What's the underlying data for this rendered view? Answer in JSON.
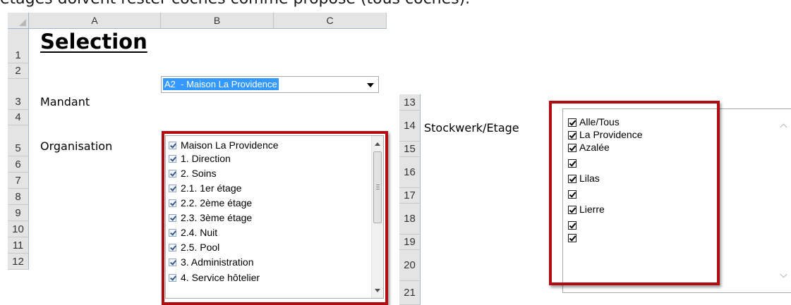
{
  "caption": "étages doivent rester cochés comme proposé (tous cochés).",
  "left_sheet": {
    "columns": [
      "A",
      "B",
      "C"
    ],
    "rows": [
      "1",
      "2",
      "3",
      "4",
      "5",
      "6",
      "7",
      "8",
      "9",
      "10",
      "11",
      "12"
    ],
    "title": "Selection",
    "mandant_label": "Mandant",
    "organisation_label": "Organisation",
    "mandant_value": "A2  - Maison La Providence",
    "organisation_items": [
      "Maison La Providence",
      "1. Direction",
      "2. Soins",
      "2.1. 1er étage",
      "2.2. 2ème étage",
      "2.3. 3ème étage",
      "2.4. Nuit",
      "2.5. Pool",
      "3. Administration",
      "4. Service hôtelier"
    ]
  },
  "right_sheet": {
    "rows": [
      "13",
      "14",
      "15",
      "16",
      "17",
      "18",
      "19",
      "20",
      "21"
    ],
    "stockwerk_label": "Stockwerk/Etage",
    "etage_items": [
      "Alle/Tous",
      "La Providence",
      "Azalée",
      "",
      "Lilas",
      "",
      "Lierre",
      "",
      ""
    ]
  },
  "colors": {
    "highlight_box": "#b00c12",
    "selection": "#3399ff",
    "header_bg": "#e4e4e4"
  }
}
